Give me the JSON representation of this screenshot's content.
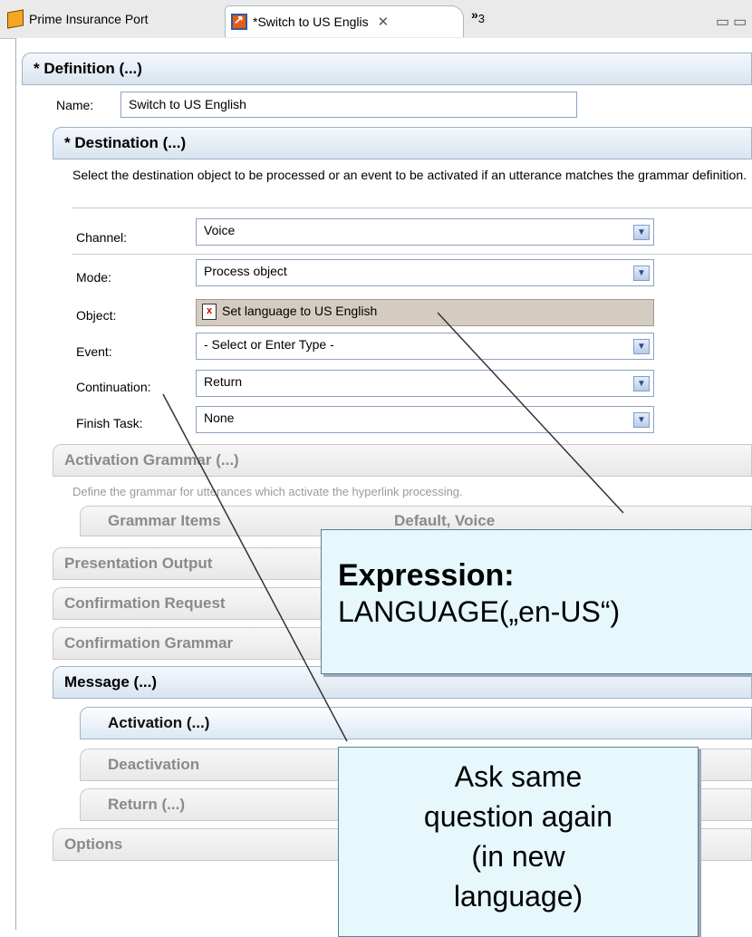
{
  "tabs": [
    {
      "label": "Prime Insurance Port",
      "icon": "component-icon"
    },
    {
      "label": "*Switch to US Englis",
      "icon": "hyperlink-icon",
      "close": "✕"
    }
  ],
  "overflow": {
    "symbol": "»",
    "count": "3"
  },
  "definition": {
    "header": "* Definition (...)",
    "name_label": "Name:",
    "name_value": "Switch to US English"
  },
  "destination": {
    "header": "* Destination (...)",
    "description": "Select the destination object to be processed or an event to be activated if an utterance matches the grammar definition.",
    "fields": {
      "channel": {
        "label": "Channel:",
        "value": "Voice"
      },
      "mode": {
        "label": "Mode:",
        "value": "Process object"
      },
      "object": {
        "label": "Object:",
        "value": "Set language to US English"
      },
      "event": {
        "label": "Event:",
        "value": "- Select or Enter Type -"
      },
      "continuation": {
        "label": "Continuation:",
        "value": "Return"
      },
      "finish_task": {
        "label": "Finish Task:",
        "value": "None"
      }
    }
  },
  "activation_grammar": {
    "header": "Activation Grammar (...)",
    "description": "Define the grammar for utterances which activate the hyperlink processing.",
    "grammar_items": "Grammar Items",
    "default_voice": "Default, Voice"
  },
  "sections": {
    "presentation_output": "Presentation Output",
    "confirmation_request": "Confirmation Request",
    "confirmation_grammar": "Confirmation Grammar",
    "message": "Message (...)",
    "activation": "Activation (...)",
    "deactivation": "Deactivation",
    "return": "Return (...)",
    "options": "Options"
  },
  "callouts": {
    "expression_title": "Expression:",
    "expression_value": "LANGUAGE(„en-US“)",
    "ask_again": [
      "Ask same",
      "question again",
      "(in new",
      "language)"
    ]
  },
  "colors": {
    "accent_blue": "#9fb3c8",
    "callout_bg": "#e6f8fc"
  }
}
